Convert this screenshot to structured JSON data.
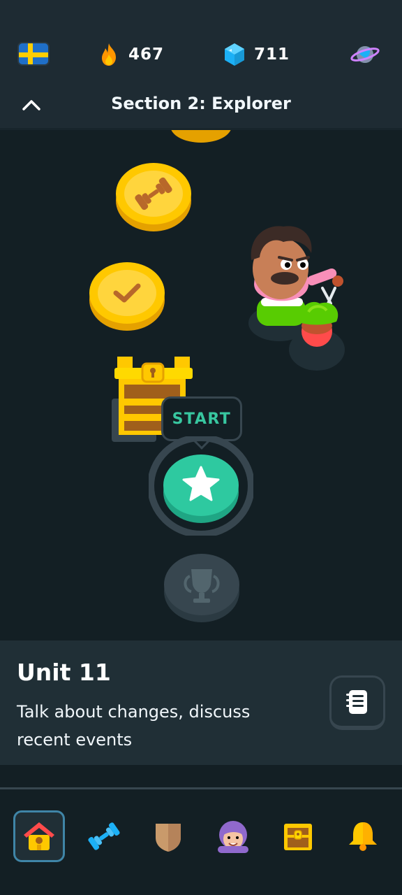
{
  "header": {
    "language_flag": "sweden-flag",
    "streak_count": "467",
    "gems_count": "711",
    "section_title": "Section 2: Explorer"
  },
  "path": {
    "start_label": "START",
    "nodes": [
      "completed-partial",
      "practice-dumbbell",
      "completed-check",
      "treasure-chest",
      "start-star",
      "locked-trophy"
    ]
  },
  "unit": {
    "title": "Unit 11",
    "description": "Talk about changes, discuss recent events"
  },
  "nav": {
    "items": [
      "home",
      "practice",
      "leagues",
      "characters",
      "shop",
      "notifications"
    ],
    "active": "home"
  },
  "colors": {
    "background": "#131f24",
    "topbar": "#1e2b33",
    "accent_green": "#38c7a0",
    "coin_gold": "#ffc800",
    "nav_active_border": "#3f85a7"
  }
}
